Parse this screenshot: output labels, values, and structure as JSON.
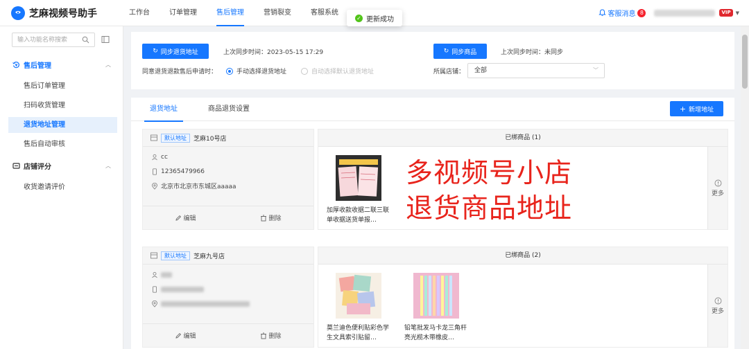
{
  "app": {
    "title": "芝麻视频号助手"
  },
  "topnav": [
    {
      "label": "工作台",
      "active": false
    },
    {
      "label": "订单管理",
      "active": false
    },
    {
      "label": "售后管理",
      "active": true
    },
    {
      "label": "营销裂变",
      "active": false
    },
    {
      "label": "客服系统",
      "active": false
    }
  ],
  "toast": {
    "text": "更新成功"
  },
  "header": {
    "service_label": "客服消息",
    "service_count": "8",
    "vip_label": "VIP"
  },
  "sidebar": {
    "search_placeholder": "输入功能名称搜索",
    "groups": [
      {
        "label": "售后管理",
        "items": [
          "售后订单管理",
          "扫码收货管理",
          "退货地址管理",
          "售后自动审核"
        ],
        "active_item": "退货地址管理"
      },
      {
        "label": "店铺评分",
        "items": [
          "收货邀请评价"
        ]
      }
    ]
  },
  "sync": {
    "return_btn": "同步退货地址",
    "return_last_sync": "上次同步时间：2023-05-15 17:29",
    "agree_label": "同意退货退款售后申请时：",
    "radio_manual": "手动选择退货地址",
    "radio_auto": "自动选择默认退货地址",
    "radio_selected": "manual",
    "goods_btn": "同步商品",
    "goods_last_sync": "上次同步时间：未同步",
    "store_label": "所属店铺：",
    "store_value": "全部"
  },
  "tabs": [
    {
      "label": "退货地址",
      "active": true
    },
    {
      "label": "商品退货设置",
      "active": false
    }
  ],
  "add_button": "新增地址",
  "addresses": [
    {
      "tag": "默认地址",
      "store": "芝麻10号店",
      "contact": "cc",
      "phone": "12365479966",
      "address": "北京市北京市东城区aaaaa",
      "bound_title": "已绑商品 (1)",
      "products": [
        {
          "name": "加厚收款收据二联三联单收据送货单报…"
        }
      ]
    },
    {
      "tag": "默认地址",
      "store": "芝麻九号店",
      "contact": "",
      "phone": "",
      "address": "",
      "bound_title": "已绑商品 (2)",
      "products": [
        {
          "name": "莫兰迪色便利贴彩色学生文具索引贴留…"
        },
        {
          "name": "铅笔批发马卡龙三角杆亮光榄木带橡皮…"
        }
      ]
    }
  ],
  "actions": {
    "edit": "编辑",
    "delete": "删除",
    "more": "更多"
  },
  "overlay": {
    "line1": "多视频号小店",
    "line2": "退货商品地址"
  },
  "colors": {
    "primary": "#1677ff",
    "overlay_red": "#e8241c",
    "success": "#52c41a"
  }
}
